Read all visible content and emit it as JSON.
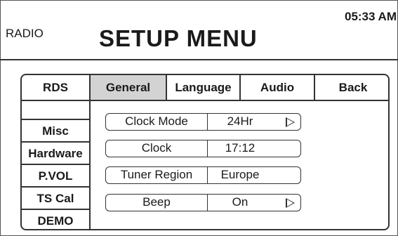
{
  "header": {
    "mode": "RADIO",
    "title": "SETUP MENU",
    "time": "05:33 AM"
  },
  "tabs": [
    {
      "label": "RDS",
      "active": false
    },
    {
      "label": "General",
      "active": true
    },
    {
      "label": "Language",
      "active": false
    },
    {
      "label": "Audio",
      "active": false
    },
    {
      "label": "Back",
      "active": false
    }
  ],
  "sidebar": {
    "items": [
      {
        "label": "Misc"
      },
      {
        "label": "Hardware"
      },
      {
        "label": "P.VOL"
      },
      {
        "label": "TS Cal"
      },
      {
        "label": "DEMO"
      }
    ]
  },
  "settings": [
    {
      "label": "Clock Mode",
      "value": "24Hr",
      "has_arrow": true
    },
    {
      "label": "Clock",
      "value": "17:12",
      "has_arrow": false
    },
    {
      "label": "Tuner Region",
      "value": "Europe",
      "has_arrow": false
    },
    {
      "label": "Beep",
      "value": "On",
      "has_arrow": true
    }
  ],
  "icons": {
    "arrow": "play-arrow-outline-icon"
  },
  "colors": {
    "active_tab": "#d3d3d3",
    "border": "#333333",
    "background": "#ffffff"
  }
}
